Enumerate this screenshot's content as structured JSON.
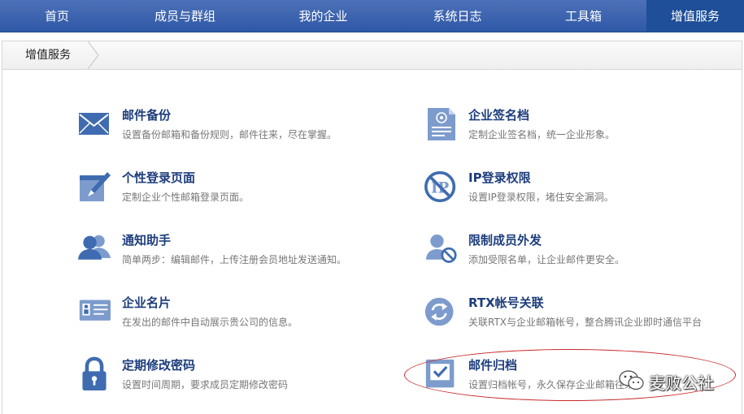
{
  "nav": {
    "items": [
      {
        "label": "首页"
      },
      {
        "label": "成员与群组"
      },
      {
        "label": "我的企业"
      },
      {
        "label": "系统日志"
      },
      {
        "label": "工具箱"
      },
      {
        "label": "增值服务"
      }
    ],
    "active": "增值服务"
  },
  "breadcrumb": {
    "label": "增值服务"
  },
  "services": {
    "left": [
      {
        "title": "邮件备份",
        "desc": "设置备份邮箱和备份规则，邮件往来，尽在掌握。",
        "icon": "mail-icon"
      },
      {
        "title": "个性登录页面",
        "desc": "定制企业个性邮箱登录页面。",
        "icon": "edit-page-icon"
      },
      {
        "title": "通知助手",
        "desc": "简单两步：编辑邮件，上传注册会员地址发送通知。",
        "icon": "users-icon"
      },
      {
        "title": "企业名片",
        "desc": "在发出的邮件中自动展示贵公司的信息。",
        "icon": "business-card-icon"
      },
      {
        "title": "定期修改密码",
        "desc": "设置时间周期，要求成员定期修改密码",
        "icon": "lock-icon"
      }
    ],
    "right": [
      {
        "title": "企业签名档",
        "desc": "定制企业签名档，统一企业形象。",
        "icon": "signature-doc-icon"
      },
      {
        "title": "IP登录权限",
        "desc": "设置IP登录权限，堵住安全漏洞。",
        "icon": "ip-block-icon"
      },
      {
        "title": "限制成员外发",
        "desc": "添加受限名单，让企业邮件更安全。",
        "icon": "user-restrict-icon"
      },
      {
        "title": "RTX帐号关联",
        "desc": "关联RTX与企业邮箱帐号，整合腾讯企业即时通信平台",
        "icon": "sync-icon"
      },
      {
        "title": "邮件归档",
        "desc": "设置归档帐号，永久保存企业邮箱往来",
        "icon": "archive-icon"
      }
    ]
  },
  "watermark": {
    "text": "麦败公社"
  },
  "colors": {
    "nav_bg": "#3a63b0",
    "nav_active": "#1e4f98",
    "title": "#1d3d7c",
    "icon": "#3f6cb0",
    "highlight": "#c8282a"
  }
}
